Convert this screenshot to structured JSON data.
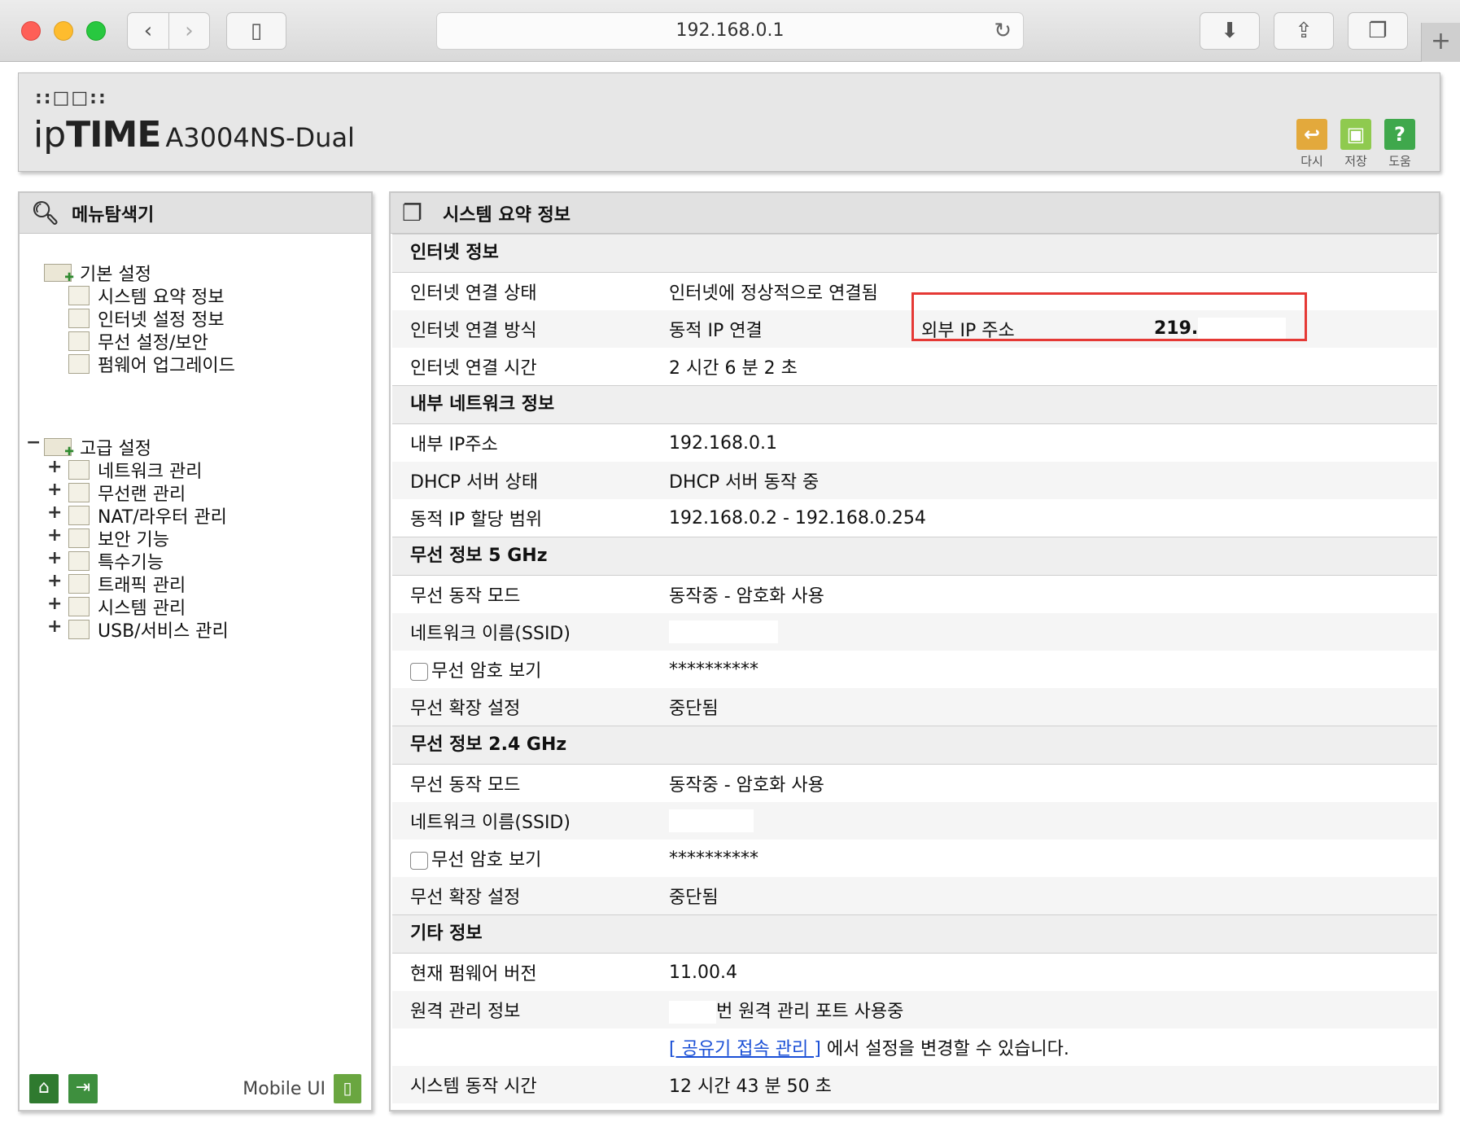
{
  "browser": {
    "url": "192.168.0.1"
  },
  "header": {
    "logo_dots": "::□□::",
    "logo_ip": "ip",
    "logo_time": "TIME",
    "model": "A3004NS-Dual",
    "buttons": {
      "redo": "다시",
      "save": "저장",
      "help": "도움"
    }
  },
  "menu": {
    "title": "메뉴탐색기",
    "basic": {
      "label": "기본 설정",
      "items": [
        "시스템 요약 정보",
        "인터넷 설정 정보",
        "무선 설정/보안",
        "펌웨어 업그레이드"
      ]
    },
    "advanced": {
      "expander": "−",
      "label": "고급 설정",
      "items": [
        "네트워크 관리",
        "무선랜 관리",
        "NAT/라우터 관리",
        "보안 기능",
        "특수기능",
        "트래픽 관리",
        "시스템 관리",
        "USB/서비스 관리"
      ],
      "expand_symbol": "+"
    },
    "footer": {
      "mobile_label": "Mobile UI"
    }
  },
  "summary": {
    "title": "시스템 요약 정보",
    "internet": {
      "title": "인터넷 정보",
      "status_label": "인터넷 연결 상태",
      "status_value": "인터넷에 정상적으로 연결됨",
      "method_label": "인터넷 연결 방식",
      "method_value": "동적 IP 연결",
      "external_ip_label": "외부 IP 주소",
      "external_ip_value": "219.",
      "time_label": "인터넷 연결 시간",
      "time_value": "2 시간 6 분 2 초"
    },
    "lan": {
      "title": "내부 네트워크 정보",
      "ip_label": "내부 IP주소",
      "ip_value": "192.168.0.1",
      "dhcp_label": "DHCP 서버 상태",
      "dhcp_value": "DHCP 서버 동작 중",
      "range_label": "동적 IP 할당 범위",
      "range_value": "192.168.0.2 -  192.168.0.254"
    },
    "wifi5": {
      "title": "무선 정보 5 GHz",
      "mode_label": "무선 동작 모드",
      "mode_value": "동작중 - 암호화 사용",
      "ssid_label": "네트워크 이름(SSID)",
      "ssid_value": "",
      "pw_label": "무선 암호 보기",
      "pw_value": "**********",
      "ext_label": "무선 확장 설정",
      "ext_value": "중단됨"
    },
    "wifi24": {
      "title": "무선 정보 2.4 GHz",
      "mode_label": "무선 동작 모드",
      "mode_value": "동작중 - 암호화 사용",
      "ssid_label": "네트워크 이름(SSID)",
      "ssid_value": "",
      "pw_label": "무선 암호 보기",
      "pw_value": "**********",
      "ext_label": "무선 확장 설정",
      "ext_value": "중단됨"
    },
    "other": {
      "title": "기타 정보",
      "fw_label": "현재 펌웨어 버전",
      "fw_value": "11.00.4",
      "remote_label": "원격 관리 정보",
      "remote_value": "번 원격 관리 포트 사용중",
      "remote_link": "[ 공유기 접속 관리 ]",
      "remote_hint": " 에서 설정을 변경할 수 있습니다.",
      "uptime_label": "시스템 동작 시간",
      "uptime_value": "12 시간 43 분 50 초"
    }
  }
}
